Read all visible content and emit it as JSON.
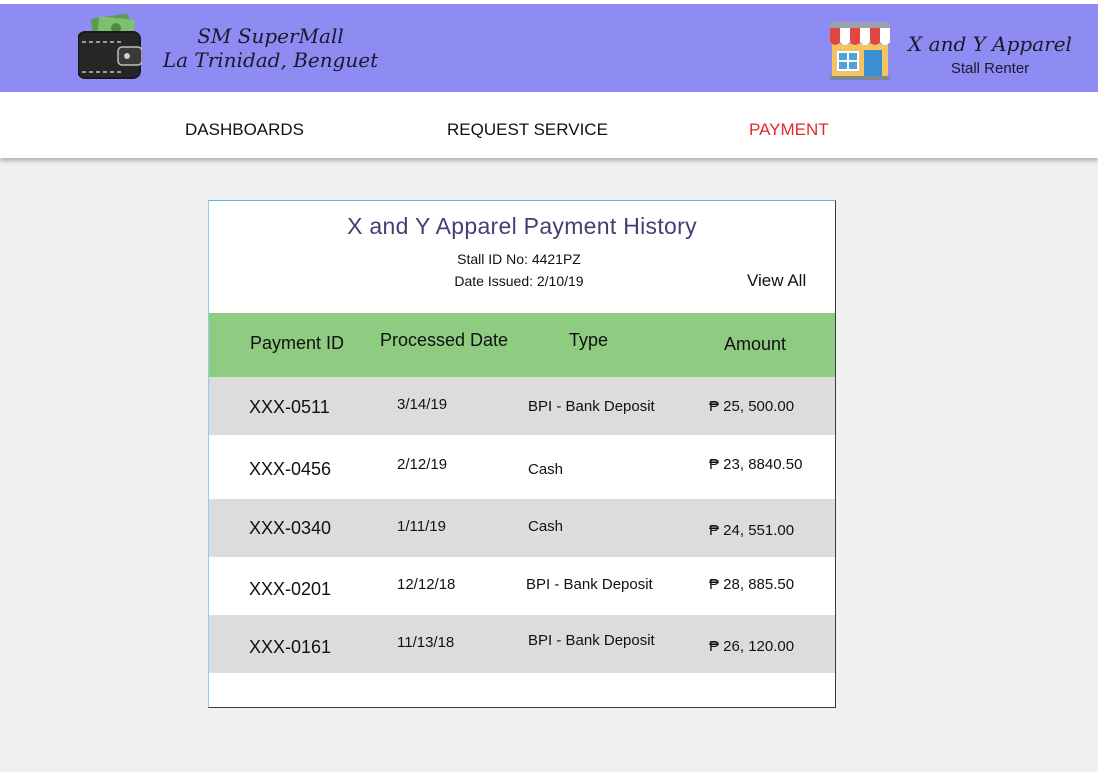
{
  "header": {
    "mall_name_line1": "SM SuperMall",
    "mall_name_line2": "La Trinidad, Benguet",
    "renter_name": "X and Y Apparel",
    "renter_role": "Stall Renter",
    "logo_icon": "wallet-money-icon",
    "store_icon": "storefront-icon",
    "background_color": "#8e8cf2"
  },
  "nav": {
    "items": [
      {
        "label": "DASHBOARDS",
        "active": false
      },
      {
        "label": "REQUEST SERVICE",
        "active": false
      },
      {
        "label": "PAYMENT",
        "active": true
      }
    ],
    "active_color": "#e5292b"
  },
  "payment_history": {
    "title": "X and Y Apparel Payment History",
    "stall_id": "Stall ID No: 4421PZ",
    "date_issued": "Date Issued: 2/10/19",
    "view_all_label": "View All",
    "header_color": "#8fcb80",
    "columns": [
      "Payment ID",
      "Processed Date",
      "Type",
      "Amount"
    ],
    "rows": [
      {
        "payment_id": "XXX-0511",
        "processed_date": "3/14/19",
        "type": "BPI - Bank Deposit",
        "amount": "₱ 25, 500.00"
      },
      {
        "payment_id": "XXX-0456",
        "processed_date": "2/12/19",
        "type": "Cash",
        "amount": "₱ 23, 8840.50"
      },
      {
        "payment_id": "XXX-0340",
        "processed_date": "1/11/19",
        "type": "Cash",
        "amount": "₱ 24, 551.00"
      },
      {
        "payment_id": "XXX-0201",
        "processed_date": "12/12/18",
        "type": "BPI - Bank Deposit",
        "amount": "₱ 28, 885.50"
      },
      {
        "payment_id": "XXX-0161",
        "processed_date": "11/13/18",
        "type": "BPI - Bank Deposit",
        "amount": "₱ 26, 120.00"
      }
    ]
  }
}
